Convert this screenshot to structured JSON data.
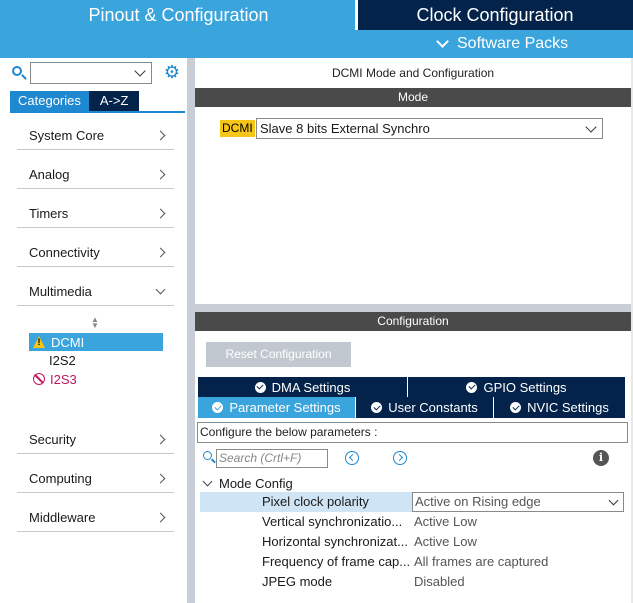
{
  "header": {
    "tab_pinout": "Pinout & Configuration",
    "tab_clock": "Clock Configuration",
    "software_packs": "Software Packs"
  },
  "sidebar": {
    "search_value": "",
    "category_tabs": [
      "Categories",
      "A->Z"
    ],
    "categories": [
      {
        "label": "System Core",
        "expanded": false
      },
      {
        "label": "Analog",
        "expanded": false
      },
      {
        "label": "Timers",
        "expanded": false
      },
      {
        "label": "Connectivity",
        "expanded": false
      },
      {
        "label": "Multimedia",
        "expanded": true
      },
      {
        "label": "Security",
        "expanded": false
      },
      {
        "label": "Computing",
        "expanded": false
      },
      {
        "label": "Middleware",
        "expanded": false
      }
    ],
    "multimedia_items": [
      {
        "label": "DCMI",
        "status": "warning",
        "selected": true
      },
      {
        "label": "I2S2",
        "status": "none",
        "selected": false
      },
      {
        "label": "I2S3",
        "status": "disabled",
        "selected": false
      }
    ]
  },
  "main": {
    "title": "DCMI Mode and Configuration",
    "mode_header": "Mode",
    "mode_label": "DCMI",
    "mode_value": "Slave 8 bits External Synchro",
    "config_header": "Configuration",
    "reset_button": "Reset Configuration",
    "tabs_row1": [
      "DMA Settings",
      "GPIO Settings"
    ],
    "tabs_row2": [
      "Parameter Settings",
      "User Constants",
      "NVIC Settings"
    ],
    "active_tab": "Parameter Settings",
    "config_banner": "Configure the below parameters :",
    "param_search_placeholder": "Search (Crtl+F)",
    "group_label": "Mode Config",
    "params": [
      {
        "name": "Pixel clock polarity",
        "value": "Active on Rising edge",
        "selected": true
      },
      {
        "name": "Vertical synchronizatio...",
        "value": "Active Low",
        "selected": false
      },
      {
        "name": "Horizontal synchronizat...",
        "value": "Active Low",
        "selected": false
      },
      {
        "name": "Frequency of frame cap...",
        "value": "All frames are captured",
        "selected": false
      },
      {
        "name": "JPEG mode",
        "value": "Disabled",
        "selected": false
      }
    ]
  },
  "colors": {
    "accent": "#3aa4dd",
    "navy": "#03234b",
    "warning": "#f5c518",
    "disabled": "#c2185b"
  }
}
